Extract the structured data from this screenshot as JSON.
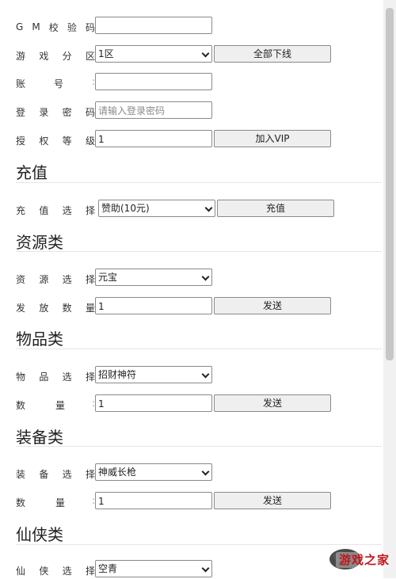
{
  "labels": {
    "gm_code": [
      "G",
      "M",
      "校",
      "验",
      "码"
    ],
    "server_zone": [
      "游",
      "戏",
      "分",
      "区"
    ],
    "account": [
      "账",
      "号"
    ],
    "login_password": [
      "登",
      "录",
      "密",
      "码"
    ],
    "auth_level": [
      "授",
      "权",
      "等",
      "级"
    ],
    "recharge_select": [
      "充",
      "值",
      "选",
      "择"
    ],
    "resource_select": [
      "资",
      "源",
      "选",
      "择"
    ],
    "issue_qty": [
      "发",
      "放",
      "数",
      "量"
    ],
    "item_select": [
      "物",
      "品",
      "选",
      "择"
    ],
    "item_qty": [
      "数",
      "量"
    ],
    "equip_select": [
      "装",
      "备",
      "选",
      "择"
    ],
    "equip_qty": [
      "数",
      "量"
    ],
    "xianxia_select": [
      "仙",
      "侠",
      "选",
      "择"
    ]
  },
  "fields": {
    "gm_code_value": "",
    "server_zone_value": "1区",
    "account_value": "",
    "login_password_placeholder": "请输入登录密码",
    "auth_level_value": "1",
    "recharge_value": "赞助(10元)",
    "resource_value": "元宝",
    "issue_qty_value": "1",
    "item_value": "招财神符",
    "item_qty_value": "1",
    "equip_value": "神威长枪",
    "equip_qty_value": "1",
    "xianxia_value": "空青"
  },
  "buttons": {
    "all_offline": "全部下线",
    "join_vip": "加入VIP",
    "recharge": "充值",
    "send_resource": "发送",
    "send_item": "发送",
    "send_equip": "发送"
  },
  "sections": {
    "recharge": "充值",
    "resource": "资源类",
    "item": "物品类",
    "equip": "装备类",
    "xianxia": "仙侠类"
  },
  "watermark": {
    "text": "游戏之家",
    "color": "#c0161b"
  }
}
